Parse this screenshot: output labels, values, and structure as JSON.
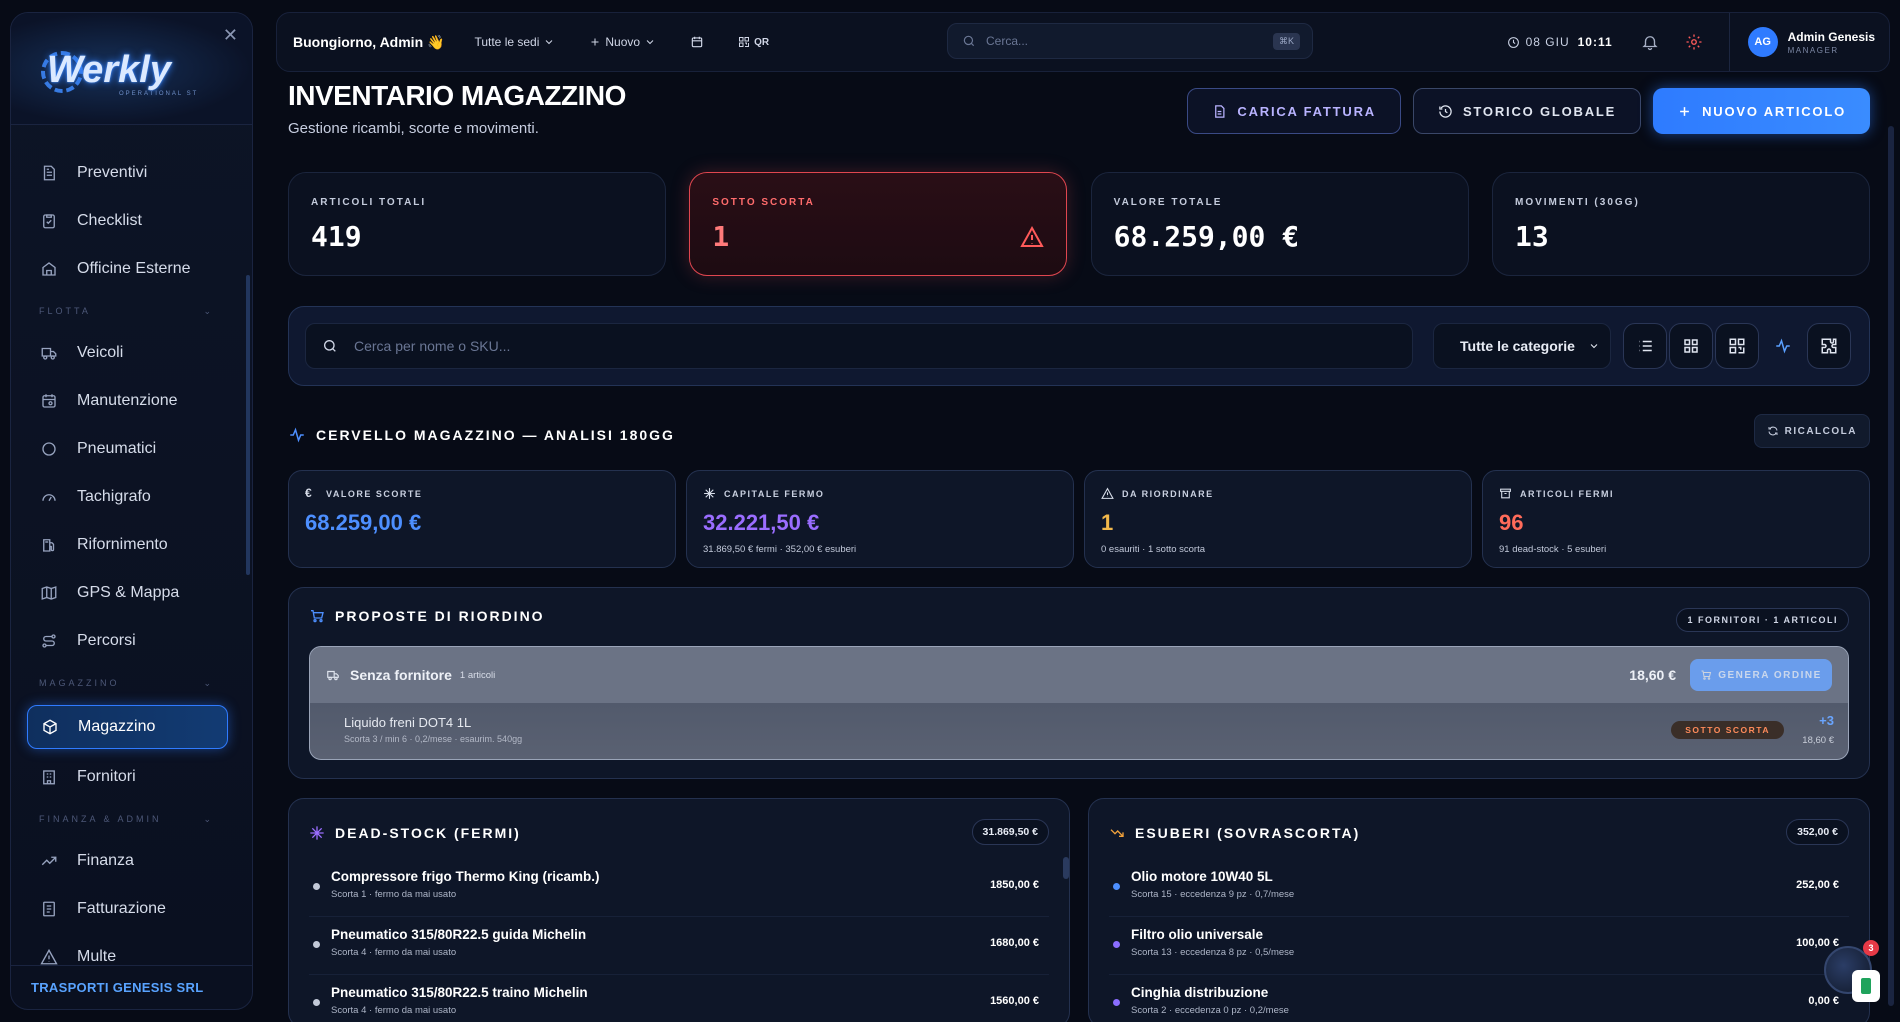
{
  "sidebar": {
    "brand": "Werkly",
    "brand_sub": "OPERATIONAL ST",
    "items_top": [
      {
        "label": "Preventivi",
        "icon": "document-icon"
      },
      {
        "label": "Checklist",
        "icon": "clipboard-icon"
      },
      {
        "label": "Officine Esterne",
        "icon": "wrench-icon"
      }
    ],
    "section_flotta": "FLOTTA",
    "items_flotta": [
      {
        "label": "Veicoli",
        "icon": "truck-icon"
      },
      {
        "label": "Manutenzione",
        "icon": "calendar-tool-icon"
      },
      {
        "label": "Pneumatici",
        "icon": "tire-icon"
      },
      {
        "label": "Tachigrafo",
        "icon": "gauge-icon"
      },
      {
        "label": "Rifornimento",
        "icon": "fuel-icon"
      },
      {
        "label": "GPS & Mappa",
        "icon": "map-icon"
      },
      {
        "label": "Percorsi",
        "icon": "route-icon"
      }
    ],
    "section_magazzino": "MAGAZZINO",
    "items_magazzino": [
      {
        "label": "Magazzino",
        "icon": "box-icon",
        "active": true
      },
      {
        "label": "Fornitori",
        "icon": "building-icon"
      }
    ],
    "section_finanza": "FINANZA & ADMIN",
    "items_finanza": [
      {
        "label": "Finanza",
        "icon": "trend-icon"
      },
      {
        "label": "Fatturazione",
        "icon": "invoice-icon"
      },
      {
        "label": "Multe",
        "icon": "warning-icon"
      }
    ],
    "company": "TRASPORTI GENESIS SRL"
  },
  "topbar": {
    "greeting": "Buongiorno, Admin 👋",
    "location_filter": "Tutte le sedi",
    "new_label": "Nuovo",
    "qr_label": "QR",
    "search_placeholder": "Cerca...",
    "search_shortcut": "⌘K",
    "date": "08 GIU",
    "time": "10:11",
    "user_initials": "AG",
    "user_name": "Admin Genesis",
    "user_role": "MANAGER"
  },
  "page": {
    "title": "INVENTARIO MAGAZZINO",
    "subtitle": "Gestione ricambi, scorte e movimenti.",
    "btn_invoice": "CARICA FATTURA",
    "btn_history": "STORICO GLOBALE",
    "btn_new": "NUOVO ARTICOLO"
  },
  "stats": [
    {
      "label": "ARTICOLI TOTALI",
      "value": "419"
    },
    {
      "label": "SOTTO SCORTA",
      "value": "1"
    },
    {
      "label": "VALORE TOTALE",
      "value": "68.259,00 €"
    },
    {
      "label": "MOVIMENTI (30GG)",
      "value": "13"
    }
  ],
  "filters": {
    "search_placeholder": "Cerca per nome o SKU...",
    "category": "Tutte le categorie"
  },
  "brain": {
    "title": "CERVELLO MAGAZZINO — ANALISI 180GG",
    "recalc": "RICALCOLA",
    "kpis": [
      {
        "label": "VALORE SCORTE",
        "value": "68.259,00 €",
        "sub": ""
      },
      {
        "label": "CAPITALE FERMO",
        "value": "32.221,50 €",
        "sub": "31.869,50 € fermi · 352,00 € esuberi"
      },
      {
        "label": "DA RIORDINARE",
        "value": "1",
        "sub": "0 esauriti · 1 sotto scorta"
      },
      {
        "label": "ARTICOLI FERMI",
        "value": "96",
        "sub": "91 dead-stock · 5 esuberi"
      }
    ]
  },
  "reorder": {
    "title": "PROPOSTE DI RIORDINO",
    "summary": "1 FORNITORI · 1 ARTICOLI",
    "supplier": "Senza fornitore",
    "supplier_count": "1 articoli",
    "supplier_total": "18,60 €",
    "order_btn": "GENERA ORDINE",
    "item_name": "Liquido freni DOT4 1L",
    "item_meta": "Scorta 3 / min 6 · 0,2/mese · esaurim. 540gg",
    "item_badge": "SOTTO SCORTA",
    "item_qty": "+3",
    "item_price": "18,60 €"
  },
  "deadstock": {
    "title": "DEAD-STOCK (FERMI)",
    "total": "31.869,50 €",
    "rows": [
      {
        "name": "Compressore frigo Thermo King (ricamb.)",
        "meta": "Scorta 1 · fermo da mai usato",
        "value": "1850,00 €"
      },
      {
        "name": "Pneumatico 315/80R22.5 guida Michelin",
        "meta": "Scorta 4 · fermo da mai usato",
        "value": "1680,00 €"
      },
      {
        "name": "Pneumatico 315/80R22.5 traino Michelin",
        "meta": "Scorta 4 · fermo da mai usato",
        "value": "1560,00 €"
      }
    ]
  },
  "surplus": {
    "title": "ESUBERI (SOVRASCORTA)",
    "total": "352,00 €",
    "rows": [
      {
        "name": "Olio motore 10W40 5L",
        "meta": "Scorta 15 · eccedenza 9 pz · 0,7/mese",
        "value": "252,00 €"
      },
      {
        "name": "Filtro olio universale",
        "meta": "Scorta 13 · eccedenza 8 pz · 0,5/mese",
        "value": "100,00 €"
      },
      {
        "name": "Cinghia distribuzione",
        "meta": "Scorta 2 · eccedenza 0 pz · 0,2/mese",
        "value": "0,00 €"
      }
    ]
  },
  "chat_badge": "3",
  "colors": {
    "accent": "#2f7bff",
    "alert": "#e0464f",
    "purple": "#9a6dff",
    "amber": "#f2b84b",
    "red": "#ff6b5a"
  }
}
